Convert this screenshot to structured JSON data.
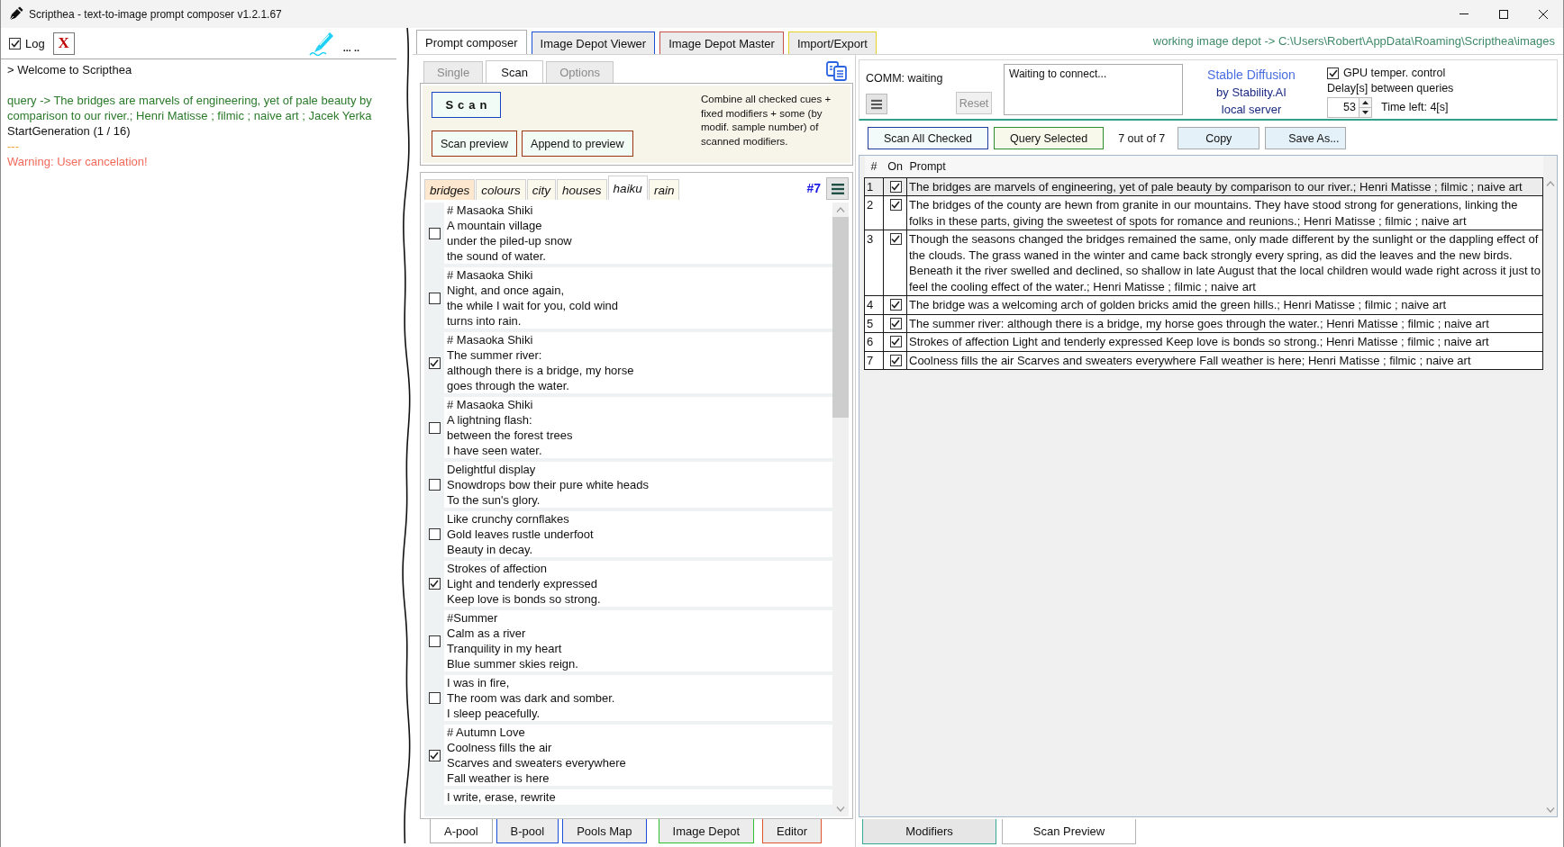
{
  "window": {
    "title": "Scripthea - text-to-image prompt composer v1.2.1.67"
  },
  "log_panel": {
    "log_checkbox": {
      "label": "Log",
      "checked": true
    },
    "clear_button": "X",
    "status": "... ..",
    "lines": [
      {
        "kind": "info",
        "text": "> Welcome to Scripthea"
      },
      {
        "kind": "query",
        "text": "query -> The bridges are marvels of engineering, yet of pale beauty by comparison to our river.; Henri Matisse ; filmic ; naive art ; Jacek Yerka"
      },
      {
        "kind": "info",
        "text": "StartGeneration (1 / 16)"
      },
      {
        "kind": "separator",
        "text": "---"
      },
      {
        "kind": "warning",
        "text": "Warning: User cancelation!"
      }
    ]
  },
  "main_tabs": [
    {
      "label": "Prompt composer",
      "selected": true,
      "color": "#adadad"
    },
    {
      "label": "Image Depot Viewer",
      "selected": false,
      "color": "#1a4fd6"
    },
    {
      "label": "Image Depot Master",
      "selected": false,
      "color": "#c8504a"
    },
    {
      "label": "Import/Export",
      "selected": false,
      "color": "#e6d02a"
    }
  ],
  "depot_path": "working image depot -> C:\\Users\\Robert\\AppData\\Roaming\\Scripthea\\images",
  "composer": {
    "sub_tabs": [
      {
        "label": "Single",
        "selected": false
      },
      {
        "label": "Scan",
        "selected": true
      },
      {
        "label": "Options",
        "selected": false
      }
    ],
    "scan_button": "Scan",
    "scan_preview_button": "Scan preview",
    "append_button": "Append to preview",
    "description": "Combine all checked cues + fixed modifiers + some (by modif. sample number) of scanned modifiers.",
    "cue_tabs": [
      {
        "label": "bridges",
        "selected": false,
        "highlighted": true
      },
      {
        "label": "colours",
        "selected": false,
        "highlighted": false
      },
      {
        "label": "city",
        "selected": false,
        "highlighted": false
      },
      {
        "label": "houses",
        "selected": false,
        "highlighted": false
      },
      {
        "label": "haiku",
        "selected": true,
        "highlighted": false
      },
      {
        "label": "rain",
        "selected": false,
        "highlighted": false
      }
    ],
    "cue_count": "#7",
    "cues": [
      {
        "checked": false,
        "text": "# Masaoka Shiki\nA mountain village\nunder the piled-up snow\nthe sound of water."
      },
      {
        "checked": false,
        "text": "# Masaoka Shiki\nNight, and once again,\nthe while I wait for you, cold wind\nturns into rain."
      },
      {
        "checked": true,
        "text": "# Masaoka Shiki\nThe summer river:\nalthough there is a bridge, my horse\ngoes through the water."
      },
      {
        "checked": false,
        "text": "# Masaoka Shiki\nA lightning flash:\nbetween the forest trees\nI have seen water."
      },
      {
        "checked": false,
        "text": "Delightful display\nSnowdrops bow their pure white heads\nTo the sun's glory."
      },
      {
        "checked": false,
        "text": "Like crunchy cornflakes\nGold leaves rustle underfoot\nBeauty in decay."
      },
      {
        "checked": true,
        "text": "Strokes of affection\nLight and tenderly expressed\nKeep love is bonds so strong."
      },
      {
        "checked": false,
        "text": "#Summer\nCalm as a river\nTranquility in my heart\nBlue summer skies reign."
      },
      {
        "checked": false,
        "text": "I was in fire,\nThe room was dark and somber.\nI sleep peacefully."
      },
      {
        "checked": true,
        "text": "# Autumn Love\nCoolness fills the air\nScarves and sweaters everywhere\nFall weather is here"
      },
      {
        "text": "I write, erase, rewrite"
      }
    ],
    "pool_tabs": [
      {
        "label": "A-pool",
        "selected": true,
        "color": "#adadad"
      },
      {
        "label": "B-pool",
        "selected": false,
        "color": "#1a4fd6"
      },
      {
        "label": "Pools Map",
        "selected": false,
        "color": "#1a4fd6"
      },
      {
        "label": "Image Depot",
        "selected": false,
        "color": "#2ec02e"
      },
      {
        "label": "Editor",
        "selected": false,
        "color": "#e0552a"
      }
    ]
  },
  "query_panel": {
    "comm_status": "COMM: waiting",
    "reset_button": {
      "label": "Reset",
      "disabled": true
    },
    "connection_log": "Waiting to connect...",
    "server": {
      "name": "Stable Diffusion",
      "by": "by Stability.AI",
      "location": "local server"
    },
    "gpu_control": {
      "label": "GPU temper. control",
      "checked": true
    },
    "delay_label": "Delay[s] between queries",
    "delay_value": "53",
    "time_left": "Time left: 4[s]",
    "actions": [
      {
        "kind": "button",
        "label": "Scan All Checked",
        "color": "#1f3c9c"
      },
      {
        "kind": "button",
        "label": "Query Selected",
        "color": "#2e8e2e"
      },
      {
        "kind": "count",
        "label": "7 out of 7"
      },
      {
        "kind": "button",
        "label": "Copy",
        "color": "#a8a8a8"
      },
      {
        "kind": "button",
        "label": "Save As...",
        "color": "#a8a8a8"
      }
    ],
    "table": {
      "columns": [
        "#",
        "On",
        "Prompt"
      ],
      "rows": [
        {
          "number": "1",
          "on": true,
          "selected": true,
          "prompt": "The bridges are marvels of engineering, yet of pale beauty by comparison to our river.; Henri Matisse ; filmic ; naive art"
        },
        {
          "number": "2",
          "on": true,
          "selected": false,
          "prompt": "The bridges of the county are hewn from granite in our mountains. They have stood strong for generations, linking the folks in these parts, giving the sweetest of spots for romance and reunions.; Henri Matisse ; filmic ; naive art"
        },
        {
          "number": "3",
          "on": true,
          "selected": false,
          "prompt": "Though the seasons changed the bridges remained the same, only made different by the sunlight or the dappling effect of the clouds. The grass waned in the winter and came back strongly every spring, as did the leaves and the new birds. Beneath it the river swelled and declined, so shallow in late August that the local children would wade right across it just to feel the cooling effect of the water.; Henri Matisse ; filmic ; naive art"
        },
        {
          "number": "4",
          "on": true,
          "selected": false,
          "prompt": "The bridge was a welcoming arch of golden bricks amid the green hills.; Henri Matisse ; filmic ; naive art"
        },
        {
          "number": "5",
          "on": true,
          "selected": false,
          "prompt": "The summer river: although there is a bridge, my horse goes through the water.; Henri Matisse ; filmic ; naive art"
        },
        {
          "number": "6",
          "on": true,
          "selected": false,
          "prompt": "Strokes of affection Light and tenderly expressed Keep love is bonds so strong.; Henri Matisse ; filmic ; naive art"
        },
        {
          "number": "7",
          "on": true,
          "selected": false,
          "prompt": "Coolness fills the air Scarves and sweaters everywhere Fall weather is here; Henri Matisse ; filmic ; naive art"
        }
      ]
    },
    "bottom_tabs": [
      {
        "label": "Modifiers",
        "selected": false,
        "color": "#3aa89a"
      },
      {
        "label": "Scan Preview",
        "selected": true,
        "color": "#b4b4b4"
      }
    ]
  }
}
